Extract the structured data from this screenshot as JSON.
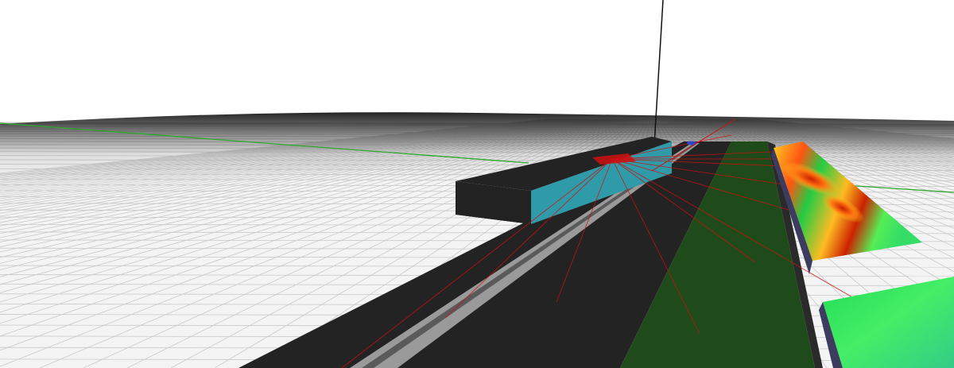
{
  "scene": {
    "colors": {
      "sky": "#ffffff",
      "ground": "#f4f4f4",
      "grid_line": "#c9c9c9",
      "horizon_shade": "#111111",
      "slab_top": "#232323",
      "slab_side": "#2f9aa8",
      "road_stripe": "#9a9a9a",
      "green_strip": "#1f4a1a",
      "x_axis": "#2ea82e",
      "y_axis": "#cc1111",
      "z_axis": "#111111",
      "laser_ray": "#d01010",
      "costmap_side": "#3c3c5e"
    },
    "costmap_palette": [
      "#22cc44",
      "#55ee55",
      "#ccee44",
      "#ffcc22",
      "#ff6611",
      "#cc2200"
    ],
    "objects": {
      "grid_plane": "grid-plane",
      "elevated_slab": "elevated-slab",
      "road": "road",
      "green_strip": "grass-strip",
      "costmap_near": "costmap-near",
      "costmap_far": "costmap-far",
      "robot_marker": "robot-marker"
    }
  }
}
